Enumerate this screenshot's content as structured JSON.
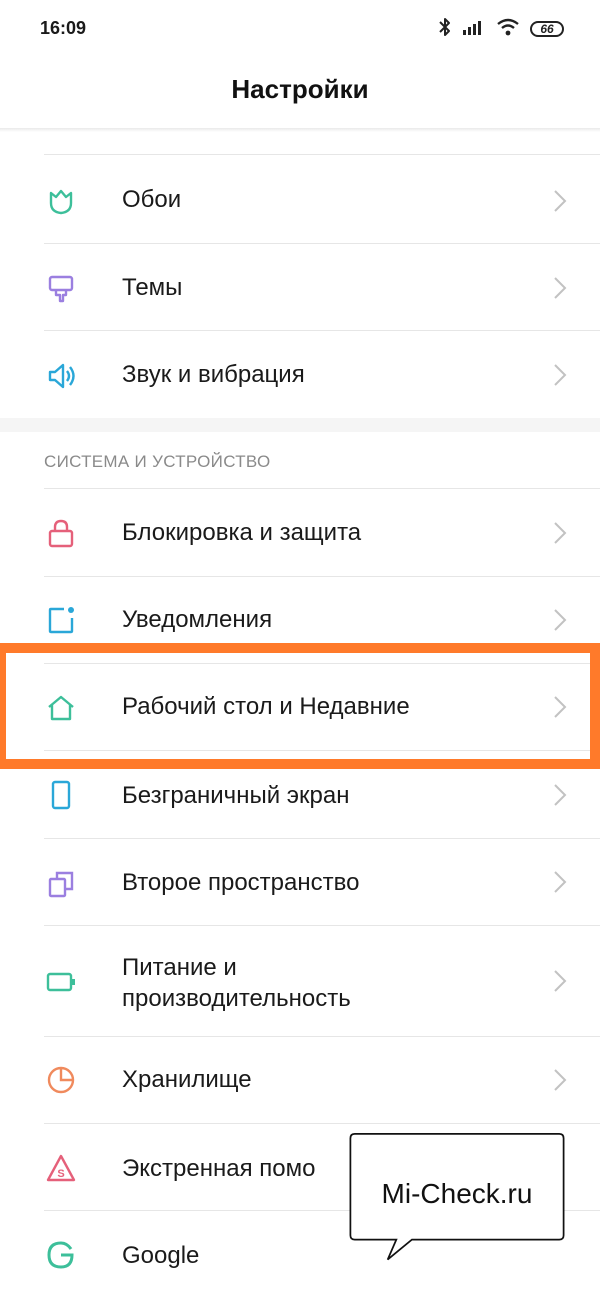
{
  "status_bar": {
    "time": "16:09",
    "battery": "66",
    "icons": [
      "bluetooth-icon",
      "signal-icon",
      "wifi-icon",
      "battery-icon"
    ]
  },
  "header": {
    "title": "Настройки"
  },
  "section_top": {
    "items": [
      {
        "label": "Обои",
        "icon": "wallpaper-icon",
        "color": "#3dbf9a"
      },
      {
        "label": "Темы",
        "icon": "themes-icon",
        "color": "#9b7fe0"
      },
      {
        "label": "Звук и вибрация",
        "icon": "sound-icon",
        "color": "#2aa7d8"
      }
    ]
  },
  "section_system": {
    "header": "СИСТЕМА И УСТРОЙСТВО",
    "items": [
      {
        "label": "Блокировка и защита",
        "icon": "lock-icon",
        "color": "#e5607a"
      },
      {
        "label": "Уведомления",
        "icon": "notifications-icon",
        "color": "#2aa7d8"
      },
      {
        "label": "Рабочий стол и Недавние",
        "icon": "home-icon",
        "color": "#3dbf9a"
      },
      {
        "label": "Безграничный экран",
        "icon": "fullscreen-icon",
        "color": "#2aa7d8"
      },
      {
        "label": "Второе пространство",
        "icon": "second-space-icon",
        "color": "#9b7fe0"
      },
      {
        "label_line1": "Питание и",
        "label_line2": "производительность",
        "icon": "battery-performance-icon",
        "color": "#3dbf9a"
      },
      {
        "label": "Хранилище",
        "icon": "storage-icon",
        "color": "#f08a5d"
      },
      {
        "label": "Экстренная помо",
        "icon": "sos-icon",
        "color": "#e5607a"
      },
      {
        "label": "Google",
        "icon": "google-icon",
        "color": "#3dbf9a"
      }
    ]
  },
  "callout": {
    "text": "Mi-Check.ru"
  },
  "colors": {
    "highlight": "#ff7a2a",
    "chevron": "#c2c2c2",
    "divider": "#e6e6e6"
  }
}
